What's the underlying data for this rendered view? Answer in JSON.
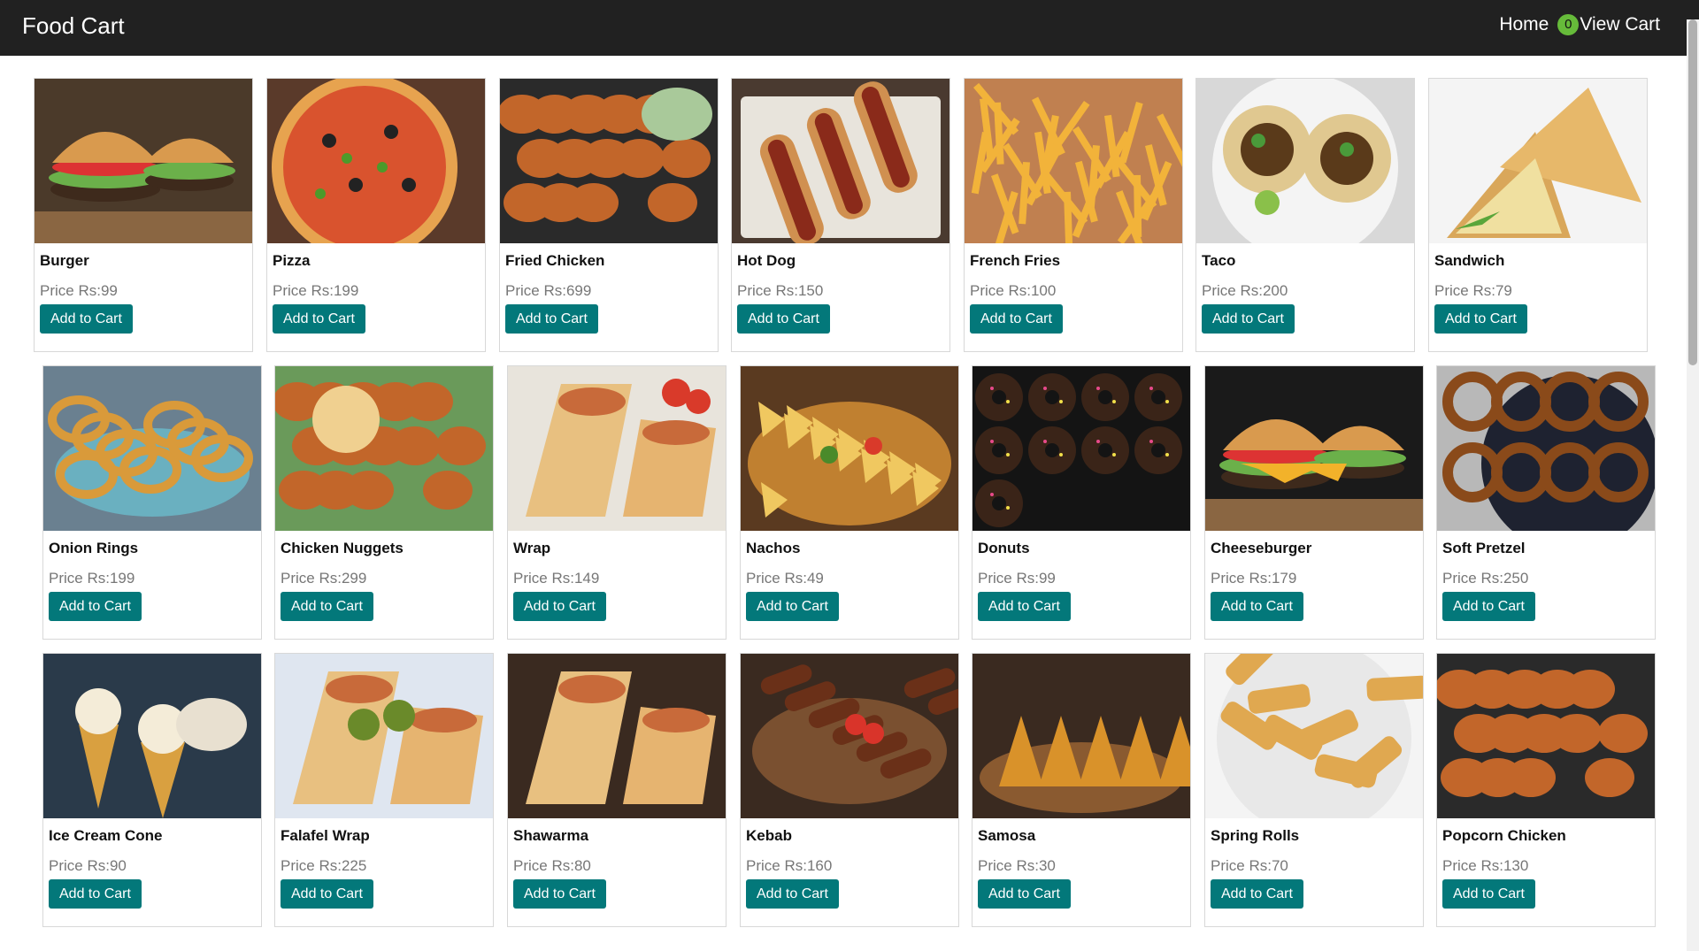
{
  "header": {
    "brand": "Food Cart",
    "home_label": "Home",
    "cart_count": "0",
    "view_cart_label": "View Cart"
  },
  "common": {
    "price_prefix": "Price Rs:",
    "add_label": "Add to Cart"
  },
  "colors": {
    "navbar": "#212121",
    "button": "#03787a",
    "badge": "#66bb3a"
  },
  "rows": [
    [
      {
        "name": "Burger",
        "price": "99",
        "image": "burger"
      },
      {
        "name": "Pizza",
        "price": "199",
        "image": "pizza"
      },
      {
        "name": "Fried Chicken",
        "price": "699",
        "image": "fried-chicken"
      },
      {
        "name": "Hot Dog",
        "price": "150",
        "image": "hot-dog"
      },
      {
        "name": "French Fries",
        "price": "100",
        "image": "french-fries"
      },
      {
        "name": "Taco",
        "price": "200",
        "image": "taco"
      },
      {
        "name": "Sandwich",
        "price": "79",
        "image": "sandwich"
      }
    ],
    [
      {
        "name": "Onion Rings",
        "price": "199",
        "image": "onion-rings"
      },
      {
        "name": "Chicken Nuggets",
        "price": "299",
        "image": "chicken-nuggets"
      },
      {
        "name": "Wrap",
        "price": "149",
        "image": "wrap"
      },
      {
        "name": "Nachos",
        "price": "49",
        "image": "nachos"
      },
      {
        "name": "Donuts",
        "price": "99",
        "image": "donuts"
      },
      {
        "name": "Cheeseburger",
        "price": "179",
        "image": "cheeseburger"
      },
      {
        "name": "Soft Pretzel",
        "price": "250",
        "image": "soft-pretzel"
      }
    ],
    [
      {
        "name": "Ice Cream Cone",
        "price": "90",
        "image": "ice-cream-cone"
      },
      {
        "name": "Falafel Wrap",
        "price": "225",
        "image": "falafel-wrap"
      },
      {
        "name": "Shawarma",
        "price": "80",
        "image": "shawarma"
      },
      {
        "name": "Kebab",
        "price": "160",
        "image": "kebab"
      },
      {
        "name": "Samosa",
        "price": "30",
        "image": "samosa"
      },
      {
        "name": "Spring Rolls",
        "price": "70",
        "image": "spring-rolls"
      },
      {
        "name": "Popcorn Chicken",
        "price": "130",
        "image": "popcorn-chicken"
      }
    ]
  ]
}
